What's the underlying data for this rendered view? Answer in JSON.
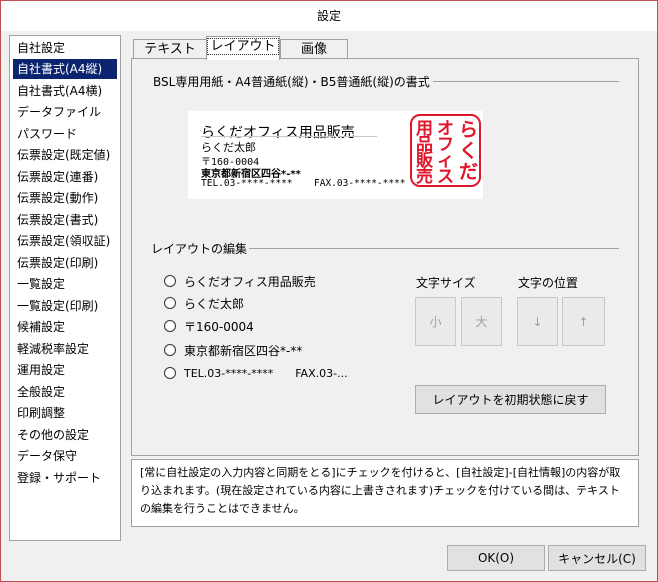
{
  "window": {
    "title": "設定"
  },
  "sidebar": {
    "selected_index": 1,
    "items": [
      {
        "label": "自社設定"
      },
      {
        "label": "自社書式(A4縦)"
      },
      {
        "label": "自社書式(A4横)"
      },
      {
        "label": "データファイル"
      },
      {
        "label": "パスワード"
      },
      {
        "label": "伝票設定(既定値)"
      },
      {
        "label": "伝票設定(連番)"
      },
      {
        "label": "伝票設定(動作)"
      },
      {
        "label": "伝票設定(書式)"
      },
      {
        "label": "伝票設定(領収証)"
      },
      {
        "label": "伝票設定(印刷)"
      },
      {
        "label": "一覧設定"
      },
      {
        "label": "一覧設定(印刷)"
      },
      {
        "label": "候補設定"
      },
      {
        "label": "軽減税率設定"
      },
      {
        "label": "運用設定"
      },
      {
        "label": "全般設定"
      },
      {
        "label": "印刷調整"
      },
      {
        "label": "その他の設定"
      },
      {
        "label": "データ保守"
      },
      {
        "label": "登録・サポート"
      }
    ]
  },
  "tabs": [
    {
      "label": "テキスト"
    },
    {
      "label": "レイアウト"
    },
    {
      "label": "画像"
    }
  ],
  "preview_group": {
    "title": "BSL専用用紙・A4普通紙(縦)・B5普通紙(縦)の書式",
    "company": "らくだオフィス用品販売",
    "person": "らくだ太郎",
    "postal": "〒160-0004",
    "address": "東京都新宿区四谷*-**",
    "tel": "TEL.03-****-****",
    "fax": "FAX.03-****-****",
    "stamp_text": "らくだオフィス用品販売",
    "stamp_color": "#e0162b"
  },
  "layout_group": {
    "title": "レイアウトの編集",
    "options": [
      {
        "label": "らくだオフィス用品販売"
      },
      {
        "label": "らくだ太郎"
      },
      {
        "label": "〒160-0004"
      },
      {
        "label": "東京都新宿区四谷*-**"
      },
      {
        "label": "TEL.03-****-****　　FAX.03-..."
      }
    ],
    "font_size_label": "文字サイズ",
    "position_label": "文字の位置",
    "small_label": "小",
    "large_label": "大",
    "down_label": "↓",
    "up_label": "↑",
    "reset_label": "レイアウトを初期状態に戻す"
  },
  "info_text": "[常に自社設定の入力内容と同期をとる]にチェックを付けると、[自社設定]-[自社情報]の内容が取り込まれます。(現在設定されている内容に上書きされます)チェックを付けている間は、テキストの編集を行うことはできません。",
  "footer": {
    "ok_label": "OK(O)",
    "cancel_label": "キャンセル(C)"
  }
}
